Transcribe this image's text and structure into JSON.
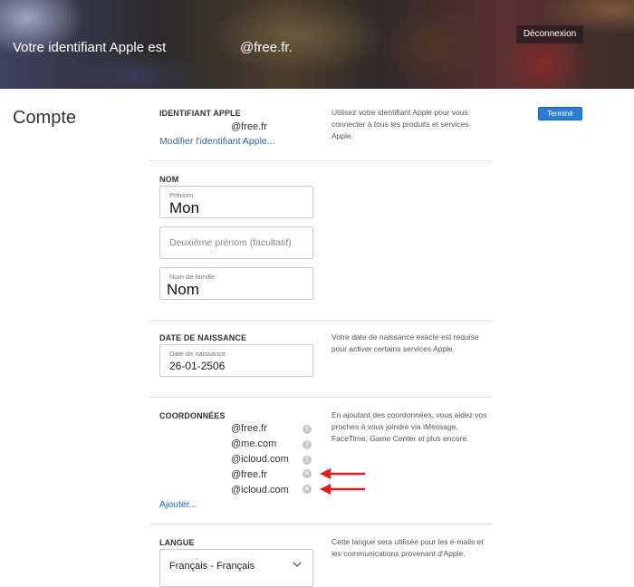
{
  "header": {
    "title_prefix": "Votre identifiant Apple est",
    "email_suffix": "@free.fr.",
    "logout_label": "Déconnexion"
  },
  "page": {
    "title": "Compte",
    "done_label": "Terminé"
  },
  "apple_id": {
    "label": "IDENTIFIANT APPLE",
    "value": "@free.fr",
    "edit_link": "Modifier l'identifiant Apple...",
    "note": "Utilisez votre identifiant Apple pour vous connecter à tous les produits et services Apple."
  },
  "name": {
    "label": "NOM",
    "first_name_label": "Prénom",
    "first_name_value": "Mon",
    "middle_name_placeholder": "Deuxième prénom (facultatif)",
    "last_name_label": "Nom de famille",
    "last_name_value": "Nom"
  },
  "birthdate": {
    "label": "DATE DE NAISSANCE",
    "field_label": "Date de naissance",
    "value": "26-01-2506",
    "note": "Votre date de naissance exacte est requise pour activer certains services Apple."
  },
  "contacts": {
    "label": "COORDONNÉES",
    "items": [
      "@free.fr",
      "@me.com",
      "@icloud.com",
      "@free.fr",
      "@icloud.com"
    ],
    "info_glyph": "!",
    "remove_glyph": "×",
    "add_link": "Ajouter...",
    "note": "En ajoutant des coordonnées, vous aidez vos proches à vous joindre via iMessage, FaceTime, Game Center et plus encore.",
    "arrow_color": "#e02020"
  },
  "language": {
    "label": "LANGUE",
    "selected": "Français - Français",
    "note": "Cette langue sera utilisée pour les e-mails et les communications provenant d'Apple."
  }
}
